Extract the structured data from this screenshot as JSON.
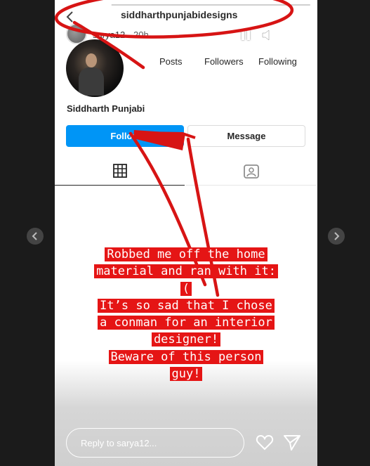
{
  "profile": {
    "username": "siddharthpunjabidesigns",
    "name": "Siddharth Punjabi",
    "stats": {
      "posts": "Posts",
      "followers": "Followers",
      "following": "Following"
    },
    "follow_label": "Follow",
    "message_label": "Message"
  },
  "story": {
    "poster": "sarya12",
    "time": "20h",
    "progress": 0.2,
    "caption_lines": [
      "Robbed me off the home",
      "material and ran with it:",
      "(",
      "It’s so sad that I chose",
      "a conman for an interior",
      "designer!",
      "Beware of this person",
      "guy!"
    ],
    "reply_placeholder": "Reply to sarya12..."
  },
  "icons": {
    "back": "back-arrow-icon",
    "pause": "pause-icon",
    "mute": "mute-icon",
    "more": "more-icon",
    "grid": "grid-icon",
    "tagged": "tagged-icon",
    "heart": "heart-icon",
    "send": "send-icon",
    "prev": "chevron-left-icon",
    "next": "chevron-right-icon"
  },
  "colors": {
    "background": "#1b1b1b",
    "follow_button": "#0095f6",
    "caption_highlight": "#e51515",
    "annotation_red": "#d71414"
  }
}
